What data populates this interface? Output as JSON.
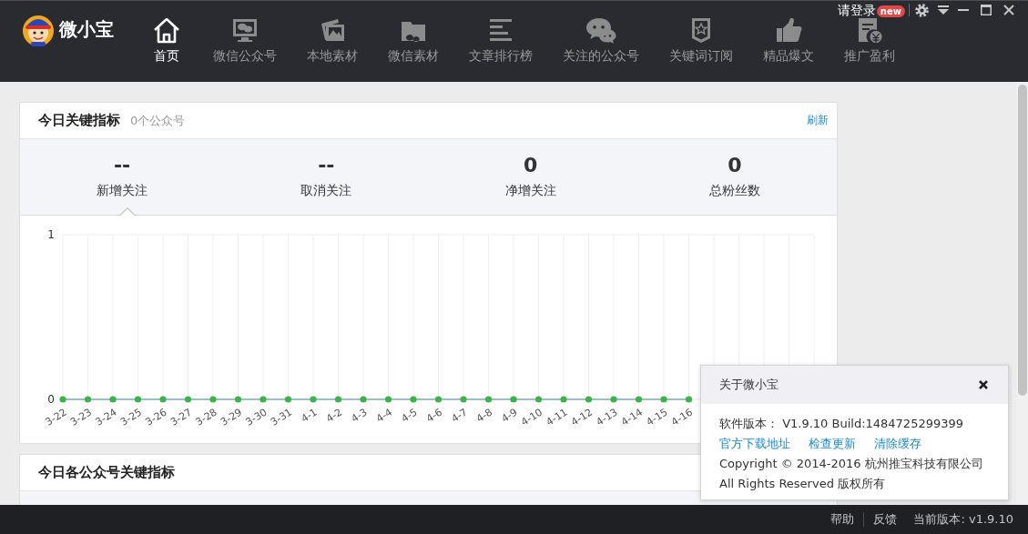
{
  "app": {
    "name": "微小宝"
  },
  "nav": [
    {
      "label": "首页",
      "selected": true
    },
    {
      "label": "微信公众号",
      "selected": false
    },
    {
      "label": "本地素材",
      "selected": false
    },
    {
      "label": "微信素材",
      "selected": false
    },
    {
      "label": "文章排行榜",
      "selected": false
    },
    {
      "label": "关注的公众号",
      "selected": false
    },
    {
      "label": "关键词订阅",
      "selected": false
    },
    {
      "label": "精品爆文",
      "selected": false
    },
    {
      "label": "推广盈利",
      "selected": false
    }
  ],
  "account": {
    "login": "请登录",
    "badge": "new"
  },
  "today_metrics": {
    "title": "今日关键指标",
    "subtitle": "0个公众号",
    "refresh": "刷新",
    "metrics": [
      {
        "value": "--",
        "label": "新增关注",
        "selected": true
      },
      {
        "value": "--",
        "label": "取消关注",
        "selected": false
      },
      {
        "value": "0",
        "label": "净增关注",
        "selected": false
      },
      {
        "value": "0",
        "label": "总粉丝数",
        "selected": false
      }
    ],
    "chart_data": {
      "type": "line",
      "categories": [
        "3-22",
        "3-23",
        "3-24",
        "3-25",
        "3-26",
        "3-27",
        "3-28",
        "3-29",
        "3-30",
        "3-31",
        "4-1",
        "4-2",
        "4-3",
        "4-4",
        "4-5",
        "4-6",
        "4-7",
        "4-8",
        "4-9",
        "4-10",
        "4-11",
        "4-12",
        "4-13",
        "4-14",
        "4-15",
        "4-16"
      ],
      "series": [
        {
          "color": "#3cb34a",
          "marker": "circle",
          "values": [
            0,
            0,
            0,
            0,
            0,
            0,
            0,
            0,
            0,
            0,
            0,
            0,
            0,
            0,
            0,
            0,
            0,
            0,
            0,
            0,
            0,
            0,
            0,
            0,
            0,
            0
          ]
        }
      ],
      "ylim": [
        0,
        1
      ],
      "yticks": [
        0,
        1
      ],
      "grid": true
    }
  },
  "account_metrics": {
    "title": "今日各公众号关键指标"
  },
  "about_dialog": {
    "title": "关于微小宝",
    "version": "软件版本： V1.9.10 Build:1484725299399",
    "links": [
      "官方下载地址",
      "检查更新",
      "清除缓存"
    ],
    "copyright": "Copyright © 2014-2016 杭州推宝科技有限公司",
    "rights": "All Rights Reserved 版权所有"
  },
  "status_bar": {
    "items": [
      "帮助",
      "反馈",
      "当前版本: v1.9.10"
    ]
  }
}
